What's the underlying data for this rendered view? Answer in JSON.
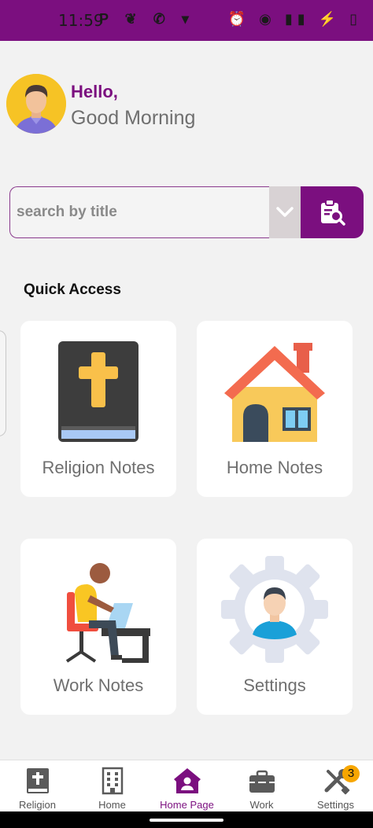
{
  "status_bar": {
    "time": "11:59",
    "left_icons": "P ❦ ✆ ▾",
    "right_icons": "⏰ ◉ ▮▮ ⚡ ▯"
  },
  "greeting": {
    "hello": "Hello,",
    "message": "Good Morning"
  },
  "search": {
    "placeholder": "search by title"
  },
  "quick_access": {
    "title": "Quick Access",
    "cards": [
      {
        "label": "Religion Notes",
        "icon": "bible-icon"
      },
      {
        "label": "Home Notes",
        "icon": "house-icon"
      },
      {
        "label": "Work Notes",
        "icon": "worker-desk-icon"
      },
      {
        "label": "Settings",
        "icon": "settings-gear-user-icon"
      }
    ]
  },
  "bottom_nav": {
    "items": [
      {
        "label": "Religion",
        "icon": "bible-icon"
      },
      {
        "label": "Home",
        "icon": "building-icon"
      },
      {
        "label": "Home Page",
        "icon": "house-user-icon",
        "active": true
      },
      {
        "label": "Work",
        "icon": "toolbox-icon"
      },
      {
        "label": "Settings",
        "icon": "tools-icon",
        "badge": "3"
      }
    ]
  },
  "colors": {
    "primary": "#7b0f7f",
    "badge": "#f7a600",
    "background": "#f2f2f2"
  }
}
